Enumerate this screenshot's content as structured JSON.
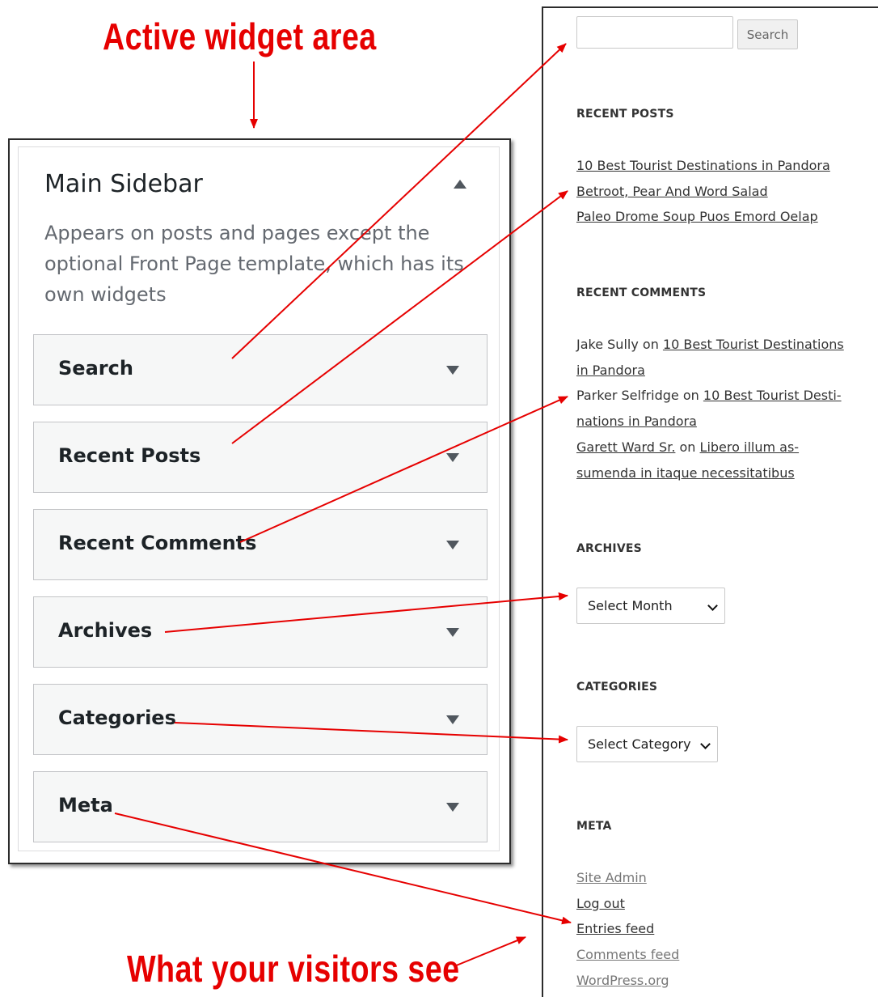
{
  "annotations": {
    "top": "Active widget area",
    "bottom": "What your visitors see"
  },
  "widget_panel": {
    "title": "Main Sidebar",
    "description": "Appears on posts and pages except the optional Front Page template, which has its own widgets",
    "widgets": [
      {
        "label": "Search"
      },
      {
        "label": "Recent Posts"
      },
      {
        "label": "Recent Comments"
      },
      {
        "label": "Archives"
      },
      {
        "label": "Categories"
      },
      {
        "label": "Meta"
      }
    ]
  },
  "frontend": {
    "search_button": "Search",
    "recent_posts": {
      "heading": "RECENT POSTS",
      "items": [
        "10 Best Tourist Destinations in Pandora",
        "Betroot, Pear And Word Salad",
        "Paleo Drome Soup Puos Emord Oelap"
      ]
    },
    "recent_comments": {
      "heading": "RECENT COMMENTS",
      "items": [
        {
          "author": "Jake Sully",
          "on": "on",
          "post_line1": "10 Best Tourist Destinations",
          "post_line2": "in Pandora"
        },
        {
          "author": "Parker Selfridge",
          "on": "on",
          "post_line1": "10 Best Tourist Desti-",
          "post_line2": "nations in Pandora"
        },
        {
          "author": "Garett Ward Sr.",
          "on": "on",
          "post_line1": "Libero illum as-",
          "post_line2": "sumenda in itaque necessitatibus"
        }
      ]
    },
    "archives": {
      "heading": "ARCHIVES",
      "select": "Select Month"
    },
    "categories": {
      "heading": "CATEGORIES",
      "select": "Select Category"
    },
    "meta": {
      "heading": "META",
      "items": [
        "Site Admin",
        "Log out",
        "Entries feed",
        "Comments feed",
        "WordPress.org"
      ]
    }
  },
  "colors": {
    "annotation": "#e60000",
    "arrow": "#e60000"
  }
}
